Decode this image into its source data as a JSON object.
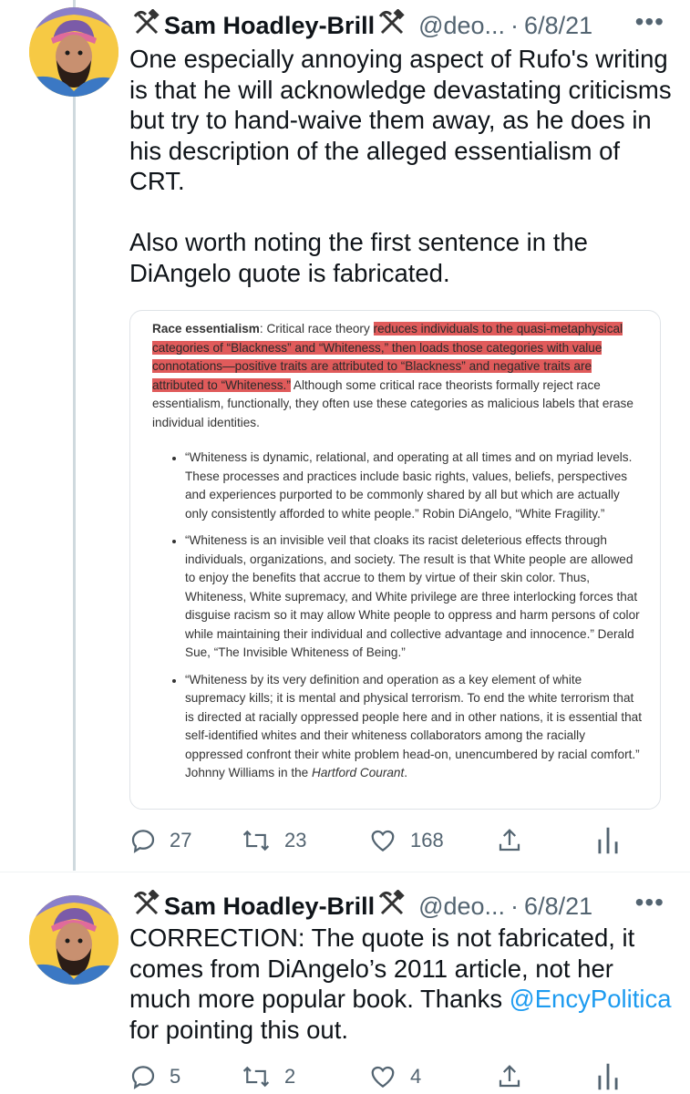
{
  "tweets": [
    {
      "name_prefix_icon": "hammer-and-pick-icon",
      "name": "Sam Hoadley-Brill",
      "handle": "@deo...",
      "separator": "·",
      "date": "6/8/21",
      "more": "•••",
      "text": "One especially annoying aspect of Rufo's writing is that he will acknowledge devastating criticisms but try to hand-waive them away, as he does in his description of the alleged essentialism of CRT.\n\nAlso worth noting the first sentence in the DiAngelo quote is fabricated.",
      "image": {
        "lead_bold": "Race essentialism",
        "lead_rest": ": Critical race theory ",
        "highlighted": "reduces individuals to the quasi-metaphysical categories of “Blackness” and “Whiteness,” then loads those categories with value connotations—positive traits are attributed to “Blackness” and negative traits are attributed to “Whiteness.”",
        "after": " Although some critical race theorists formally reject race essentialism, functionally, they often use these categories as malicious labels that erase individual identities.",
        "bullets": [
          "“Whiteness is dynamic, relational, and operating at all times and on myriad levels. These processes and practices include basic rights, values, beliefs, perspectives and experiences purported to be commonly shared by all but which are actually only consistently afforded to white people.” Robin DiAngelo, “White Fragility.”",
          "“Whiteness is an invisible veil that cloaks its racist deleterious effects through individuals, organizations, and society. The result is that White people are allowed to enjoy the benefits that accrue to them by virtue of their skin color. Thus, Whiteness, White supremacy, and White privilege are three interlocking forces that disguise racism so it may allow White people to oppress and harm persons of color while maintaining their individual and collective advantage and innocence.” Derald Sue, “The Invisible Whiteness of Being.”"
        ],
        "bullet3_main": "“Whiteness by its very definition and operation as a key element of white supremacy kills; it is mental and physical terrorism. To end the white terrorism that is directed at racially oppressed people here and in other nations, it is essential that self-identified whites and their whiteness collaborators among the racially oppressed confront their white problem head-on, unencumbered by racial comfort.” Johnny Williams in the ",
        "bullet3_italic": "Hartford Courant",
        "bullet3_end": "."
      },
      "replies": "27",
      "retweets": "23",
      "likes": "168"
    },
    {
      "name": "Sam Hoadley-Brill",
      "handle": "@deo...",
      "separator": "·",
      "date": "6/8/21",
      "more": "•••",
      "text_before": "CORRECTION: The quote is not fabricated, it comes from DiAngelo’s 2011 article, not her much more popular book. Thanks ",
      "mention": "@EncyPolitica",
      "text_after": " for pointing this out.",
      "replies": "5",
      "retweets": "2",
      "likes": "4"
    }
  ],
  "colors": {
    "text": "#0f1419",
    "secondary": "#536471",
    "link": "#1d9bf0",
    "highlight": "#e05b5b",
    "thread_line": "#cfd9de"
  }
}
